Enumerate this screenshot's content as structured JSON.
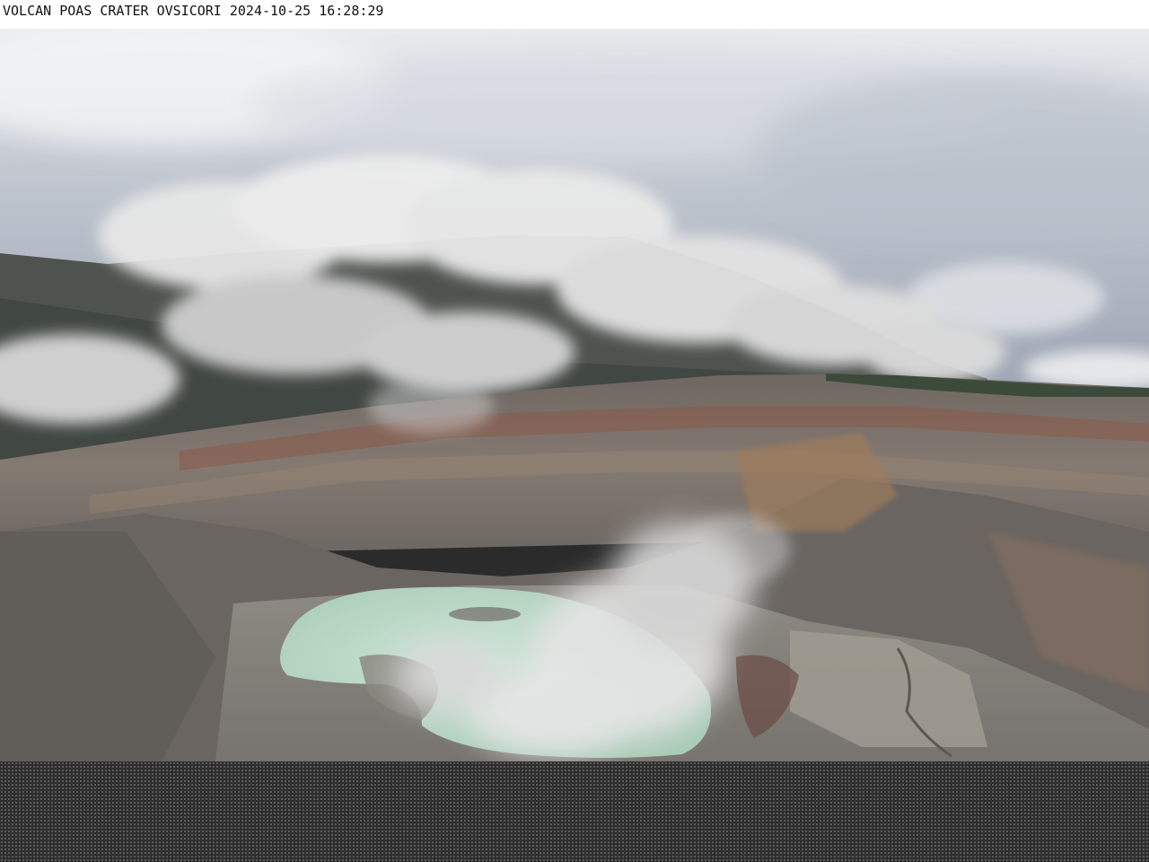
{
  "caption": {
    "text": "VOLCAN POAS CRATER OVSICORI 2024-10-25 16:28:29"
  },
  "colors": {
    "sky": "#c9ced6",
    "cloud": "#e6e6e6",
    "crater_rock": "#7a7470",
    "lake": "#b9d8c6",
    "bottom_band": "#2e2e2e"
  }
}
